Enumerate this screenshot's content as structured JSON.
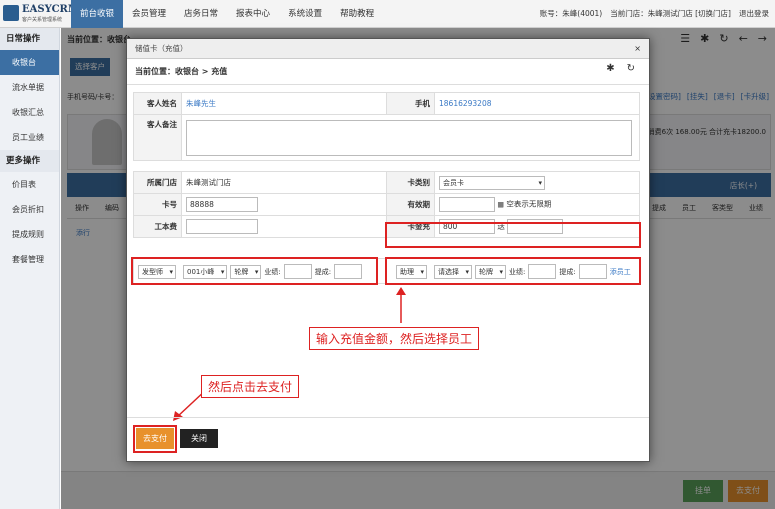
{
  "app": {
    "logo_name": "EASYCRM",
    "logo_sub": "客户关系管理系统"
  },
  "nav": [
    "前台收银",
    "会员管理",
    "店务日常",
    "报表中心",
    "系统设置",
    "帮助教程"
  ],
  "topinfo": {
    "account": "账号：朱峰(4001)",
    "store": "当前门店：朱峰测试门店 [切换门店]",
    "logout": "退出登录"
  },
  "sidebar": {
    "head1": "日常操作",
    "items1": [
      "收银台",
      "流水单据",
      "收银汇总",
      "员工业绩"
    ],
    "head2": "更多操作",
    "items2": [
      "价目表",
      "会员折扣",
      "提成规则",
      "套餐管理"
    ]
  },
  "bg": {
    "crumb": "当前位置：收银台",
    "select_customer": "选择客户",
    "phone_label": "手机号码/卡号：",
    "links": [
      "[设置密码]",
      "[挂失]",
      "[退卡]",
      "[卡升级]"
    ],
    "stats": "累计消费6次 168.00元 合计充卡18200.0",
    "cashier_label": "店长(+)",
    "cols": [
      "操作",
      "编码",
      "提成",
      "员工",
      "客类型",
      "业绩"
    ],
    "add_row": "添行",
    "hang_label": "挂单",
    "pay_label": "去支付"
  },
  "modal": {
    "title": "储值卡（充值）",
    "close": "×",
    "crumb": "当前位置：收银台 > 充值",
    "customer_name_label": "客人姓名",
    "customer_name": "朱峰先生",
    "phone_label": "手机",
    "phone": "18616293208",
    "remark_label": "客人备注",
    "store_label": "所属门店",
    "store": "朱峰测试门店",
    "card_type_label": "卡类别",
    "card_type": "会员卡",
    "card_no_label": "卡号",
    "card_no": "88888",
    "validity_label": "有效期",
    "validity_hint": "空表示无限期",
    "cost_label": "工本费",
    "amount_label": "卡金充",
    "amount": "800",
    "gift_label": "送",
    "emp1_role": "发型师",
    "emp1_name": "001小峰",
    "emp1_type": "轮牌",
    "perf_label": "业绩:",
    "comm_label": "提成:",
    "emp2_role": "助理",
    "emp2_name": "请选择",
    "emp2_type": "轮牌",
    "add_staff": "添员工",
    "pay_button": "去支付",
    "close_button": "关闭"
  },
  "annotations": {
    "callout1": "输入充值金额，然后选择员工",
    "callout2": "然后点击去支付"
  }
}
